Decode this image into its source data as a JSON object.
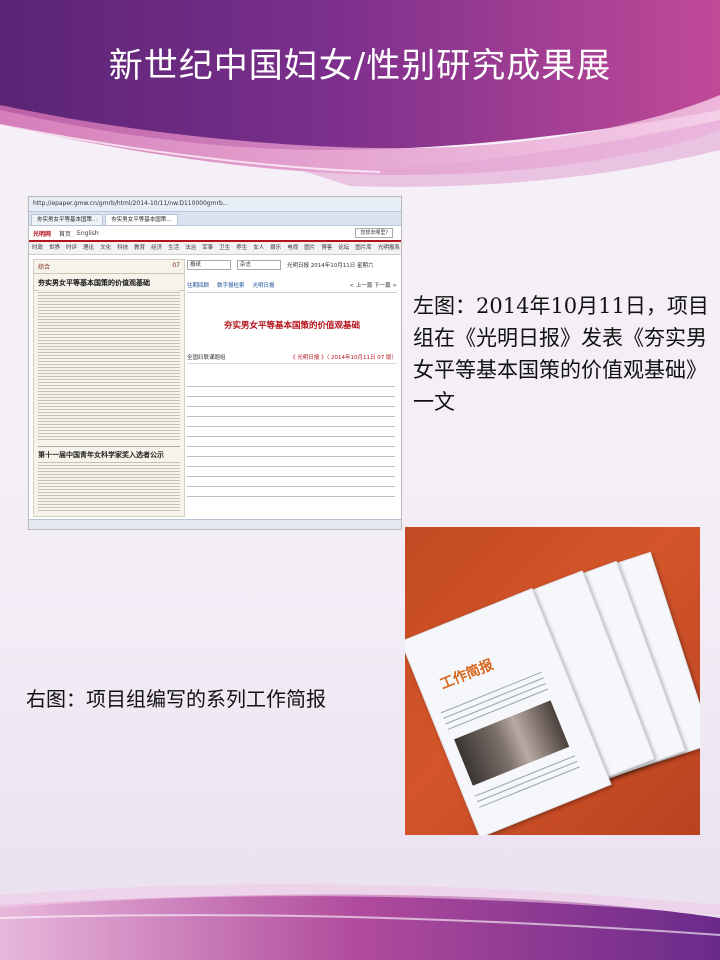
{
  "slide": {
    "title": "新世纪中国妇女/性别研究成果展",
    "caption_left": "左图：2014年10月11日，项目组在《光明日报》发表《夯实男女平等基本国策的价值观基础》一文",
    "caption_right": "右图：项目组编写的系列工作简报"
  },
  "screenshot": {
    "address_url": "http://epaper.gmw.cn/gmrb/html/2014-10/11/nw.D110000gmrb...",
    "tab_1": "夯实男女平等基本国策...",
    "tab_2": "夯实男女平等基本国策...",
    "site_logo": "光明网",
    "home_link": "首页",
    "english_link": "English",
    "search_button": "您想去哪里?",
    "nav_items": [
      "时政",
      "世界",
      "时评",
      "理论",
      "文化",
      "科技",
      "教育",
      "经济",
      "生活",
      "法治",
      "军事",
      "卫生",
      "养生",
      "女人",
      "娱乐",
      "电视",
      "图片",
      "博客",
      "论坛",
      "图片库",
      "光明报系",
      "更多"
    ],
    "paper_page_name": "综合",
    "paper_page_no": "07",
    "paper_headline": "夯实男女平等基本国策的价值观基础",
    "paper_bottom_headline": "第十一届中国青年女科学家奖入选者公示",
    "filter_1": "报纸",
    "filter_2": "杂志",
    "date_text": "光明日报 2014年10月11日 星期六",
    "links": [
      "往期回顾",
      "数字报检索",
      "光明日报"
    ],
    "pager": "< 上一篇  下一篇 >",
    "article_title": "夯实男女平等基本国策的价值观基础",
    "byline": "全国妇联课题组",
    "source": "《 光明日报 》（ 2014年10月11日   07 版）"
  },
  "bulletins": {
    "cover_title": "工作简报"
  },
  "colors": {
    "banner_purple": "#6a2a8a",
    "banner_magenta": "#c0307f",
    "accent_red": "#b5121b"
  }
}
